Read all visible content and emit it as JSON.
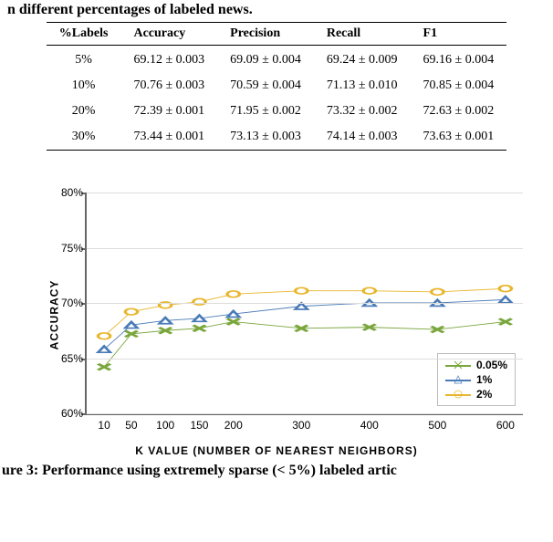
{
  "fragment_top": "n different percentages of labeled news.",
  "table": {
    "headers": [
      "%Labels",
      "Accuracy",
      "Precision",
      "Recall",
      "F1"
    ],
    "rows": [
      [
        "5%",
        "69.12 ± 0.003",
        "69.09 ± 0.004",
        "69.24 ± 0.009",
        "69.16 ± 0.004"
      ],
      [
        "10%",
        "70.76 ± 0.003",
        "70.59 ± 0.004",
        "71.13 ± 0.010",
        "70.85 ± 0.004"
      ],
      [
        "20%",
        "72.39 ± 0.001",
        "71.95 ± 0.002",
        "73.32 ± 0.002",
        "72.63 ± 0.002"
      ],
      [
        "30%",
        "73.44 ± 0.001",
        "73.13 ± 0.003",
        "74.14 ± 0.003",
        "73.63 ± 0.001"
      ]
    ]
  },
  "chart_data": {
    "type": "line",
    "xlabel": "K VALUE (NUMBER OF NEAREST NEIGHBORS)",
    "ylabel": "ACCURACY",
    "x": [
      10,
      50,
      100,
      150,
      200,
      300,
      400,
      500,
      600
    ],
    "ylim": [
      60,
      80
    ],
    "yticks": [
      60,
      65,
      70,
      75,
      80
    ],
    "series": [
      {
        "name": "0.05%",
        "color": "#7aa63d",
        "marker": "x",
        "values": [
          64.2,
          67.2,
          67.5,
          67.7,
          68.3,
          67.7,
          67.8,
          67.6,
          68.3
        ]
      },
      {
        "name": "1%",
        "color": "#4a7bb7",
        "marker": "triangle",
        "values": [
          65.8,
          68.0,
          68.4,
          68.6,
          69.0,
          69.7,
          70.0,
          70.0,
          70.3
        ]
      },
      {
        "name": "2%",
        "color": "#e8b62e",
        "marker": "circle",
        "values": [
          67.0,
          69.2,
          69.8,
          70.1,
          70.8,
          71.1,
          71.1,
          71.0,
          71.3
        ]
      }
    ]
  },
  "legend": {
    "items": [
      {
        "label": "0.05%",
        "color": "#7aa63d",
        "marker": "x"
      },
      {
        "label": "1%",
        "color": "#4a7bb7",
        "marker": "triangle"
      },
      {
        "label": "2%",
        "color": "#e8b62e",
        "marker": "circle"
      }
    ]
  },
  "fragment_bottom": "ure 3: Performance using extremely sparse (< 5%) labeled artic"
}
